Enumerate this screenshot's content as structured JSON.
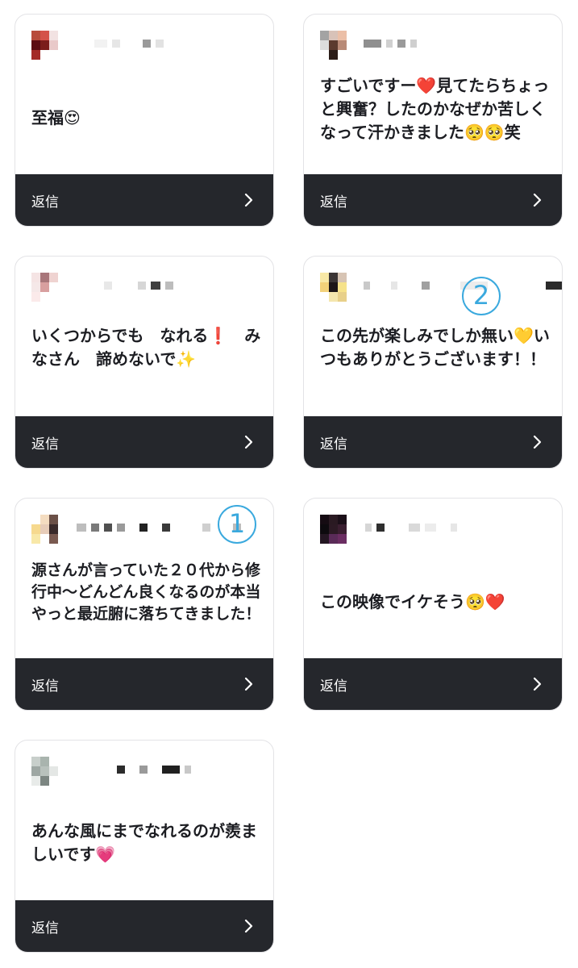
{
  "reply_label": "返信",
  "cards": [
    {
      "message": "至福😍",
      "avatar": [
        "#b84b3a",
        "#d4534a",
        "#f2e2e2",
        "#ffffff",
        "#5b0c12",
        "#7b1d1b",
        "#e9c9c9",
        "#ffffff",
        "#a42b27",
        "#ffffff",
        "#ffffff",
        "#ffffff"
      ],
      "name_blocks": [
        [
          "#f2f2f2",
          16
        ],
        [
          "#e6e6e6",
          10
        ],
        [
          "#ffffff",
          16
        ],
        [
          "#9a9a9a",
          10
        ],
        [
          "#e2e2e2",
          10
        ]
      ]
    },
    {
      "message": "すごいですー❤️見てたらちょっと興奮？したのかなぜか苦しくなって汗かきました🥺🥺笑",
      "avatar": [
        "#a3a3a3",
        "#d8c2b8",
        "#ebbfa7",
        "#ffffff",
        "#dddddd",
        "#5b3a2e",
        "#b88a77",
        "#ffffff",
        "#ffffff",
        "#2b1d18",
        "#ffffff",
        "#ffffff"
      ],
      "name_blocks": [
        [
          "#8f8f8f",
          22
        ],
        [
          "#d0d0d0",
          8
        ],
        [
          "#9a9a9a",
          10
        ],
        [
          "#cfcfcf",
          8
        ]
      ]
    },
    {
      "message": "いくつからでも　なれる❗️　みなさん　諦めないで✨",
      "avatar": [
        "#f5e4e4",
        "#a8767a",
        "#efd3d1",
        "#ffffff",
        "#f5e8e8",
        "#d89f9f",
        "#ffffff",
        "#ffffff",
        "#fbeaea",
        "#ffffff",
        "#ffffff",
        "#ffffff"
      ],
      "name_blocks": [
        [
          "#e8e8e8",
          10
        ],
        [
          "#ffffff",
          20
        ],
        [
          "#d6d6d6",
          10
        ],
        [
          "#3f3f3f",
          12
        ],
        [
          "#bdbdbd",
          10
        ]
      ]
    },
    {
      "message": "この先が楽しみでしか無い💛いつもありがとうございます！！",
      "avatar": [
        "#f8e8a6",
        "#3b3535",
        "#d7c4b4",
        "#ffffff",
        "#f2d17a",
        "#1d1618",
        "#f6e28a",
        "#ffffff",
        "#ffffff",
        "#f4e6ad",
        "#e8d08a",
        "#ffffff"
      ],
      "name_blocks": [
        [
          "#c9c9c9",
          8
        ],
        [
          "#ffffff",
          14
        ],
        [
          "#e6e6e6",
          8
        ],
        [
          "#ffffff",
          18
        ],
        [
          "#a0a0a0",
          10
        ],
        [
          "#ffffff",
          26
        ],
        [
          "#ececec",
          34
        ],
        [
          "#ffffff",
          60
        ],
        [
          "#2a2a2a",
          22
        ]
      ]
    },
    {
      "message": "源さんが言っていた２０代から修行中〜どんどん良くなるのが本当やっと最近腑に落ちてきました！",
      "avatar": [
        "#ffffff",
        "#f4dcc0",
        "#6b5047",
        "#ffffff",
        "#f6d98e",
        "#e7ccb8",
        "#3a2a2a",
        "#ffffff",
        "#f8e8a8",
        "#ffffff",
        "#7a5a50",
        "#ffffff"
      ],
      "name_blocks": [
        [
          "#bdbdbd",
          12
        ],
        [
          "#7a7a7a",
          10
        ],
        [
          "#505050",
          10
        ],
        [
          "#9a9a9a",
          10
        ],
        [
          "#ffffff",
          6
        ],
        [
          "#222222",
          10
        ],
        [
          "#ffffff",
          6
        ],
        [
          "#3a3a3a",
          10
        ],
        [
          "#ffffff",
          28
        ],
        [
          "#cfcfcf",
          10
        ],
        [
          "#ffffff",
          16
        ],
        [
          "#bdbdbd",
          10
        ]
      ]
    },
    {
      "message": "この映像でイケそう🥺❤️",
      "avatar": [
        "#150b12",
        "#2a1a22",
        "#1b0f18",
        "#ffffff",
        "#0d0a0e",
        "#2c1a24",
        "#3a1e30",
        "#ffffff",
        "#241622",
        "#5a2b58",
        "#6b2d62",
        "#ffffff"
      ],
      "name_blocks": [
        [
          "#d6d6d6",
          8
        ],
        [
          "#2f2f2f",
          10
        ],
        [
          "#ffffff",
          18
        ],
        [
          "#d9d9d9",
          14
        ],
        [
          "#ececec",
          14
        ],
        [
          "#ffffff",
          6
        ],
        [
          "#e6e6e6",
          8
        ]
      ]
    },
    {
      "message": "あんな風にまでなれるのが羨ましいです💗",
      "avatar": [
        "#c8cfcb",
        "#a9b4ae",
        "#ffffff",
        "#ffffff",
        "#9ea7a3",
        "#b8c1bc",
        "#e4e7e5",
        "#ffffff",
        "#e8ebe9",
        "#7c8682",
        "#ffffff",
        "#ffffff"
      ],
      "name_blocks": [
        [
          "#ffffff",
          40
        ],
        [
          "#2c2c2c",
          10
        ],
        [
          "#ffffff",
          6
        ],
        [
          "#9a9a9a",
          10
        ],
        [
          "#ffffff",
          6
        ],
        [
          "#202020",
          22
        ],
        [
          "#c8c8c8",
          8
        ]
      ]
    }
  ],
  "annotations": [
    {
      "label": "②"
    },
    {
      "label": "①"
    }
  ]
}
